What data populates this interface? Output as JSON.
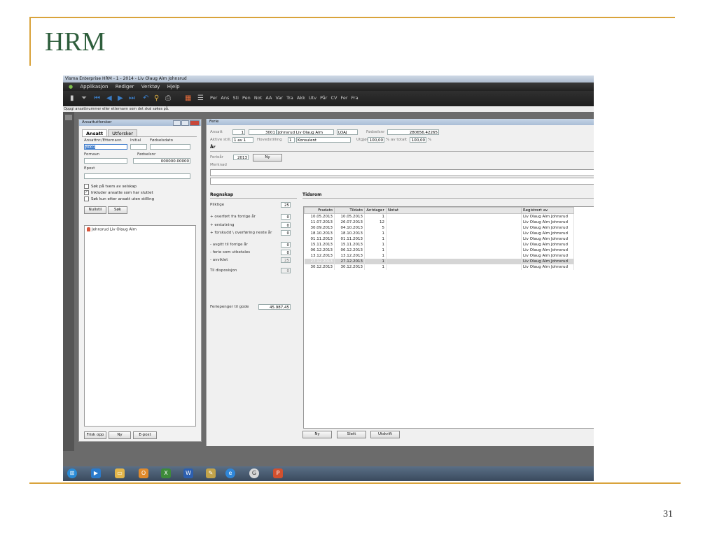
{
  "slide": {
    "title": "HRM",
    "page_number": "31"
  },
  "window": {
    "title": "Visma Enterprise HRM - 1 - 2014 - Liv Olaug Alm Johnsrud",
    "menu": [
      "Applikasjon",
      "Rediger",
      "Verktøy",
      "Hjelp"
    ],
    "toolbar_labels": "Per  Ans  Sti  Pen  Not  AA  Var  Tra  Akk  Utv  Pår  CV  Fer  Fra",
    "hint": "Oppgi ansattnummer eller etternavn som det skal søkes på."
  },
  "explorer": {
    "title": "Ansattutforsker",
    "tabs": [
      "Ansatt",
      "Utforsker"
    ],
    "labels": {
      "ansattnr": "Ansattnr./Etternavn",
      "initial": "Initial",
      "fodselsdato": "Fødselsdato",
      "fornavn": "Fornavn",
      "fodselsnr": "Fødselsnr",
      "epost": "Epost"
    },
    "values": {
      "ansattnr": "3001",
      "fodselsnr": "000000.00000"
    },
    "checks": [
      {
        "label": "Søk på tvers av selskap",
        "checked": false
      },
      {
        "label": "Inkluder ansatte som har sluttet",
        "checked": true
      },
      {
        "label": "Søk kun etter ansatt uten stilling",
        "checked": false
      }
    ],
    "buttons": {
      "reset": "Nullstil",
      "search": "Søk"
    },
    "results": [
      "Johnsrud Liv Olaug Alm"
    ],
    "footer_buttons": [
      "Frisk opp",
      "Ny",
      "E-post"
    ]
  },
  "ferie": {
    "title": "Ferie",
    "ansatt_label": "Ansatt",
    "ansatt_company": "1",
    "ansatt_nr": "3001",
    "ansatt_name": "Johnsrud Liv Olaug Alm",
    "ansatt_code": "LOAJ",
    "fodselsnr_label": "Fødselsnr",
    "fodselsnr_value": "280656.42265",
    "aktive_label": "Aktive still.",
    "aktive_value": "1 av 1",
    "hovedstilling_label": "Hovedstilling",
    "hovedstilling_value": "1",
    "stilling": "Konsulent",
    "utgjor_label": "Utgjør",
    "utgjor_value": "100,00",
    "av_totalt": "% av totalt",
    "totalt_value": "100,00",
    "percent": "%",
    "ar_section": "År",
    "ferieaar_label": "Ferieår",
    "ferieaar_value": "2013",
    "ny_button": "Ny",
    "merknad_label": "Merknad",
    "regnskap_section": "Regnskap",
    "regnskap": [
      {
        "label": "Pliktige",
        "value": "25"
      },
      {
        "label": "+ overført fra forrige år",
        "value": "0"
      },
      {
        "label": "+ erstatning",
        "value": "0"
      },
      {
        "label": "+ forskudd \\ overføring neste år",
        "value": "0"
      },
      {
        "label": "- avgitt til forrige år",
        "value": "0"
      },
      {
        "label": "- ferie som utbetales",
        "value": "0"
      },
      {
        "label": "- avviklet",
        "value": "25"
      },
      {
        "label": "Til disposisjon",
        "value": "0"
      }
    ],
    "feriepenger_label": "Feriepenger til gode",
    "feriepenger_value": "45.987,45",
    "tidsrom_section": "Tidsrom",
    "columns": [
      "Fradato",
      "Tildato",
      "Antdager",
      "Notat",
      "Registrert av"
    ],
    "rows": [
      [
        "10.05.2013",
        "10.05.2013",
        "1",
        "",
        "Liv Olaug Alm Johnsrud"
      ],
      [
        "11.07.2013",
        "26.07.2013",
        "12",
        "",
        "Liv Olaug Alm Johnsrud"
      ],
      [
        "30.09.2013",
        "04.10.2013",
        "5",
        "",
        "Liv Olaug Alm Johnsrud"
      ],
      [
        "18.10.2013",
        "18.10.2013",
        "1",
        "",
        "Liv Olaug Alm Johnsrud"
      ],
      [
        "01.11.2013",
        "01.11.2013",
        "1",
        "",
        "Liv Olaug Alm Johnsrud"
      ],
      [
        "15.11.2013",
        "15.11.2013",
        "1",
        "",
        "Liv Olaug Alm Johnsrud"
      ],
      [
        "06.12.2013",
        "06.12.2013",
        "1",
        "",
        "Liv Olaug Alm Johnsrud"
      ],
      [
        "13.12.2013",
        "13.12.2013",
        "1",
        "",
        "Liv Olaug Alm Johnsrud"
      ],
      [
        "27.12.2013",
        "27.12.2013",
        "1",
        "",
        "Liv Olaug Alm Johnsrud"
      ],
      [
        "30.12.2013",
        "30.12.2013",
        "1",
        "",
        "Liv Olaug Alm Johnsrud"
      ]
    ],
    "grid_buttons": [
      "Ny",
      "Slett",
      "Utskrift"
    ]
  },
  "colors": {
    "accent": "#d9a33b",
    "title": "#2e5e3c",
    "selection": "#3b79c9"
  }
}
